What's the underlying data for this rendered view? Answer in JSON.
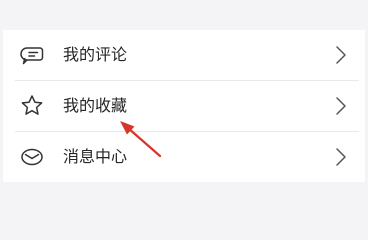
{
  "menu": {
    "items": [
      {
        "label": "我的评论",
        "icon": "comment-icon"
      },
      {
        "label": "我的收藏",
        "icon": "star-icon"
      },
      {
        "label": "消息中心",
        "icon": "envelope-icon"
      }
    ]
  },
  "colors": {
    "page_background": "#f4f4f6",
    "card_background": "#ffffff",
    "text": "#262626",
    "icon_stroke": "#333333",
    "chevron": "#555555",
    "annotation_arrow": "#d9342b"
  }
}
